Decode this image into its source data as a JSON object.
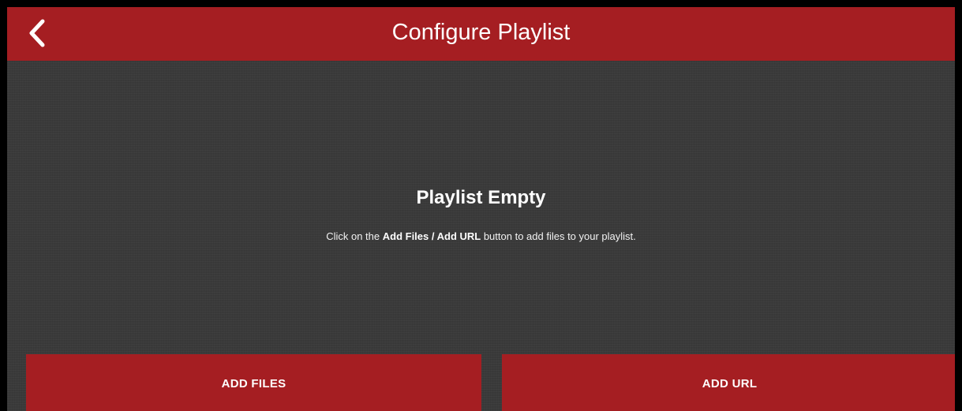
{
  "header": {
    "title": "Configure Playlist",
    "back_icon": "chevron-left-icon",
    "background_color": "#a51e22"
  },
  "empty_state": {
    "title": "Playlist Empty",
    "message_prefix": "Click on the ",
    "message_bold": "Add Files / Add URL",
    "message_suffix": " button to add files to your playlist."
  },
  "actions": {
    "add_files_label": "ADD FILES",
    "add_url_label": "ADD URL"
  },
  "colors": {
    "accent": "#a51e22",
    "background": "#3a3a3a",
    "text": "#ffffff"
  }
}
